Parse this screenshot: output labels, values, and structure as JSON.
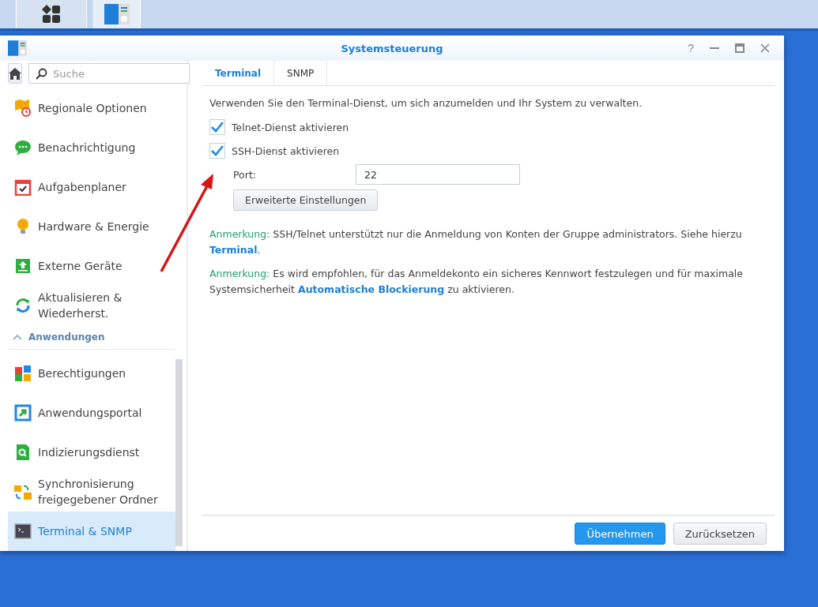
{
  "taskbar": {
    "buttons": [
      {
        "selected": false
      },
      {
        "selected": true
      }
    ]
  },
  "window": {
    "title": "Systemsteuerung",
    "controls": [
      "?"
    ]
  },
  "sidebar": {
    "search": {
      "placeholder": "Suche"
    },
    "items": [
      {
        "label": "Regionale Optionen",
        "selected": false
      },
      {
        "label": "Benachrichtigung",
        "selected": false
      },
      {
        "label": "Aufgabenplaner",
        "selected": false
      },
      {
        "label": "Hardware & Energie",
        "selected": false
      },
      {
        "label": "Externe Geräte",
        "selected": false
      },
      {
        "label": "Aktualisieren & Wiederherst.",
        "selected": false
      }
    ],
    "group": {
      "label": "Anwendungen",
      "expanded": true,
      "items": [
        {
          "label": "Berechtigungen",
          "selected": false
        },
        {
          "label": "Anwendungsportal",
          "selected": false
        },
        {
          "label": "Indizierungsdienst",
          "selected": false
        },
        {
          "label": "Synchronisierung freigegebener Ordner",
          "selected": false
        },
        {
          "label": "Terminal & SNMP",
          "selected": true
        }
      ]
    }
  },
  "tabs": [
    {
      "label": "Terminal",
      "selected": true
    },
    {
      "label": "SNMP",
      "selected": false
    }
  ],
  "intro": "Verwenden Sie den Terminal-Dienst, um sich anzumelden und Ihr System zu verwalten.",
  "checkboxes": [
    {
      "label": "Telnet-Dienst aktivieren",
      "checked": true
    },
    {
      "label": "SSH-Dienst aktivieren",
      "checked": true
    }
  ],
  "port": {
    "label": "Port:",
    "value": "22"
  },
  "advanced_button": "Erweiterte Einstellungen",
  "notes": [
    {
      "label": "Anmerkung:",
      "text": "SSH/Telnet unterstützt nur die Anmeldung von Konten der Gruppe administrators. Siehe hierzu",
      "link": "Terminal",
      "after": "."
    },
    {
      "label": "Anmerkung:",
      "text": "Es wird empfohlen, für das Anmeldekonto ein sicheres Kennwort festzulegen und für maximale Systemsicherheit",
      "link": "Automatische Blockierung",
      "after": "zu aktivieren."
    }
  ],
  "footer": {
    "buttons": [
      {
        "label": "Übernehmen",
        "kind": "primary"
      },
      {
        "label": "Zurücksetzen",
        "kind": "secondary"
      }
    ]
  }
}
